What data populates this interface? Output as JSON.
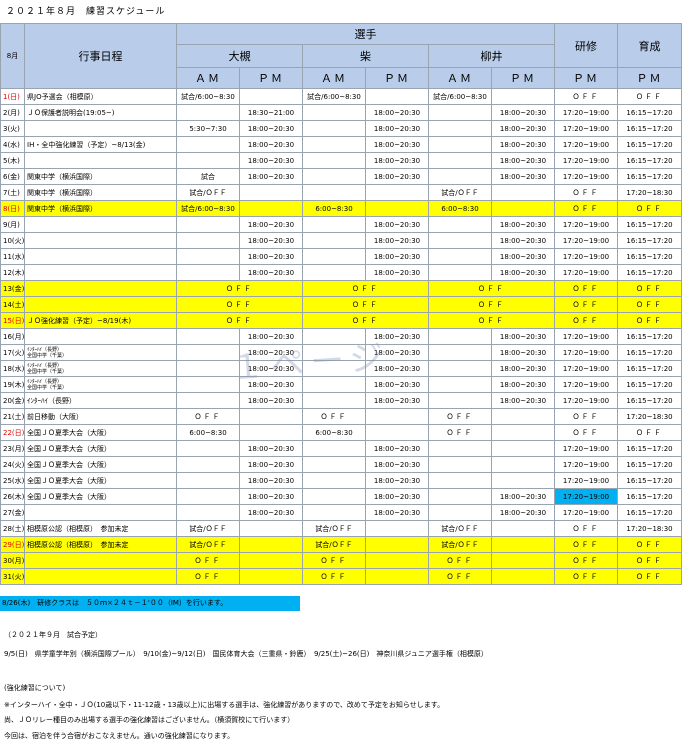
{
  "title": "２０２１年８月　練習スケジュール",
  "header": {
    "month": "8月",
    "event": "行事日程",
    "senshu": "選手",
    "kenshu": "研修",
    "ikusei": "育成",
    "coaches": [
      "大槻",
      "柴",
      "柳井"
    ],
    "am": "ＡＭ",
    "pm": "ＰＭ"
  },
  "rows": [
    {
      "date": "1(日)",
      "red": true,
      "event": "県JO予選会（相模原）",
      "c": [
        "試合/6:00~8:30",
        "",
        "試合/6:00~8:30",
        "",
        "試合/6:00~8:30",
        "",
        "ＯＦＦ",
        "ＯＦＦ"
      ]
    },
    {
      "date": "2(月)",
      "event": "ＪＯ保護者説明会(19:05~)",
      "c": [
        "",
        "18:30~21:00",
        "",
        "18:00~20:30",
        "",
        "18:00~20:30",
        "17:20~19:00",
        "16:15~17:20"
      ]
    },
    {
      "date": "3(火)",
      "event": "",
      "c": [
        "5:30~7:30",
        "18:00~20:30",
        "",
        "18:00~20:30",
        "",
        "18:00~20:30",
        "17:20~19:00",
        "16:15~17:20"
      ]
    },
    {
      "date": "4(水)",
      "event": "IH・全中強化練習（予定）~8/13(金)",
      "c": [
        "",
        "18:00~20:30",
        "",
        "18:00~20:30",
        "",
        "18:00~20:30",
        "17:20~19:00",
        "16:15~17:20"
      ]
    },
    {
      "date": "5(木)",
      "event": "",
      "c": [
        "",
        "18:00~20:30",
        "",
        "18:00~20:30",
        "",
        "18:00~20:30",
        "17:20~19:00",
        "16:15~17:20"
      ]
    },
    {
      "date": "6(金)",
      "event": "関東中学（横浜国際）",
      "c": [
        "試合",
        "18:00~20:30",
        "",
        "18:00~20:30",
        "",
        "18:00~20:30",
        "17:20~19:00",
        "16:15~17:20"
      ]
    },
    {
      "date": "7(土)",
      "event": "関東中学（横浜国際）",
      "c": [
        "試合/ＯＦＦ",
        "",
        "",
        "",
        "試合/ＯＦＦ",
        "",
        "ＯＦＦ",
        "17:20~18:30"
      ]
    },
    {
      "date": "8(日)",
      "red": true,
      "yellow": true,
      "event": "関東中学（横浜国際）",
      "c": [
        "試合/6:00~8:30",
        "",
        "6:00~8:30",
        "",
        "6:00~8:30",
        "",
        "ＯＦＦ",
        "ＯＦＦ"
      ]
    },
    {
      "date": "9(月)",
      "event": "",
      "c": [
        "",
        "18:00~20:30",
        "",
        "18:00~20:30",
        "",
        "18:00~20:30",
        "17:20~19:00",
        "16:15~17:20"
      ]
    },
    {
      "date": "10(火)",
      "event": "",
      "c": [
        "",
        "18:00~20:30",
        "",
        "18:00~20:30",
        "",
        "18:00~20:30",
        "17:20~19:00",
        "16:15~17:20"
      ]
    },
    {
      "date": "11(水)",
      "event": "",
      "c": [
        "",
        "18:00~20:30",
        "",
        "18:00~20:30",
        "",
        "18:00~20:30",
        "17:20~19:00",
        "16:15~17:20"
      ]
    },
    {
      "date": "12(木)",
      "event": "",
      "c": [
        "",
        "18:00~20:30",
        "",
        "18:00~20:30",
        "",
        "18:00~20:30",
        "17:20~19:00",
        "16:15~17:20"
      ]
    },
    {
      "date": "13(金)",
      "yellow": true,
      "event": "",
      "span": [
        "ＯＦＦ",
        "ＯＦＦ",
        "ＯＦＦ"
      ],
      "c2": [
        "ＯＦＦ",
        "ＯＦＦ"
      ]
    },
    {
      "date": "14(土)",
      "yellow": true,
      "event": "",
      "span": [
        "ＯＦＦ",
        "ＯＦＦ",
        "ＯＦＦ"
      ],
      "c2": [
        "ＯＦＦ",
        "ＯＦＦ"
      ]
    },
    {
      "date": "15(日)",
      "red": true,
      "yellow": true,
      "event": "ＪＯ強化練習（予定）~8/19(木)",
      "span": [
        "ＯＦＦ",
        "ＯＦＦ",
        "ＯＦＦ"
      ],
      "c2": [
        "ＯＦＦ",
        "ＯＦＦ"
      ]
    },
    {
      "date": "16(月)",
      "event": "",
      "c": [
        "",
        "18:00~20:30",
        "",
        "18:00~20:30",
        "",
        "18:00~20:30",
        "17:20~19:00",
        "16:15~17:20"
      ]
    },
    {
      "date": "17(火)",
      "event2": [
        "ｲﾝﾀｰﾊｲ（長野）",
        "全国中学（千葉）"
      ],
      "c": [
        "",
        "18:00~20:30",
        "",
        "18:00~20:30",
        "",
        "18:00~20:30",
        "17:20~19:00",
        "16:15~17:20"
      ]
    },
    {
      "date": "18(水)",
      "event2": [
        "ｲﾝﾀｰﾊｲ（長野）",
        "全国中学（千葉）"
      ],
      "c": [
        "",
        "18:00~20:30",
        "",
        "18:00~20:30",
        "",
        "18:00~20:30",
        "17:20~19:00",
        "16:15~17:20"
      ]
    },
    {
      "date": "19(木)",
      "event2": [
        "ｲﾝﾀｰﾊｲ（長野）",
        "全国中学（千葉）"
      ],
      "c": [
        "",
        "18:00~20:30",
        "",
        "18:00~20:30",
        "",
        "18:00~20:30",
        "17:20~19:00",
        "16:15~17:20"
      ]
    },
    {
      "date": "20(金)",
      "event": "ｲﾝﾀｰﾊｲ（長野）",
      "c": [
        "",
        "18:00~20:30",
        "",
        "18:00~20:30",
        "",
        "18:00~20:30",
        "17:20~19:00",
        "16:15~17:20"
      ]
    },
    {
      "date": "21(土)",
      "event": "前日移動（大阪）",
      "c": [
        "ＯＦＦ",
        "",
        "ＯＦＦ",
        "",
        "ＯＦＦ",
        "",
        "ＯＦＦ",
        "17:20~18:30"
      ]
    },
    {
      "date": "22(日)",
      "red": true,
      "event": "全国ＪＯ夏季大会（大阪）",
      "c": [
        "6:00~8:30",
        "",
        "6:00~8:30",
        "",
        "ＯＦＦ",
        "",
        "ＯＦＦ",
        "ＯＦＦ"
      ]
    },
    {
      "date": "23(月)",
      "event": "全国ＪＯ夏季大会（大阪）",
      "c": [
        "",
        "18:00~20:30",
        "",
        "18:00~20:30",
        "",
        "",
        "17:20~19:00",
        "16:15~17:20"
      ]
    },
    {
      "date": "24(火)",
      "event": "全国ＪＯ夏季大会（大阪）",
      "c": [
        "",
        "18:00~20:30",
        "",
        "18:00~20:30",
        "",
        "",
        "17:20~19:00",
        "16:15~17:20"
      ]
    },
    {
      "date": "25(水)",
      "event": "全国ＪＯ夏季大会（大阪）",
      "c": [
        "",
        "18:00~20:30",
        "",
        "18:00~20:30",
        "",
        "",
        "17:20~19:00",
        "16:15~17:20"
      ]
    },
    {
      "date": "26(木)",
      "event": "全国ＪＯ夏季大会（大阪）",
      "blueKenshu": true,
      "c": [
        "",
        "18:00~20:30",
        "",
        "18:00~20:30",
        "",
        "18:00~20:30",
        "17:20~19:00",
        "16:15~17:20"
      ]
    },
    {
      "date": "27(金)",
      "event": "",
      "c": [
        "",
        "18:00~20:30",
        "",
        "18:00~20:30",
        "",
        "18:00~20:30",
        "17:20~19:00",
        "16:15~17:20"
      ]
    },
    {
      "date": "28(土)",
      "event": "相模原公認（相模原）　参加未定",
      "c": [
        "試合/ＯＦＦ",
        "",
        "試合/ＯＦＦ",
        "",
        "試合/ＯＦＦ",
        "",
        "ＯＦＦ",
        "17:20~18:30"
      ]
    },
    {
      "date": "29(日)",
      "red": true,
      "yellow": true,
      "event": "相模原公認（相模原）　参加未定",
      "c": [
        "試合/ＯＦＦ",
        "",
        "試合/ＯＦＦ",
        "",
        "試合/ＯＦＦ",
        "",
        "ＯＦＦ",
        "ＯＦＦ"
      ]
    },
    {
      "date": "30(月)",
      "yellow": true,
      "event": "",
      "c": [
        "ＯＦＦ",
        "",
        "ＯＦＦ",
        "",
        "ＯＦＦ",
        "",
        "ＯＦＦ",
        "ＯＦＦ"
      ]
    },
    {
      "date": "31(火)",
      "yellow": true,
      "event": "",
      "c": [
        "ＯＦＦ",
        "",
        "ＯＦＦ",
        "",
        "ＯＦＦ",
        "",
        "ＯＦＦ",
        "ＯＦＦ"
      ]
    }
  ],
  "watermark": "１ページ",
  "note_bar": "8/26(木)　研修クラスは　５０ｍ×２４ｔ－１'００（IM）を行います。",
  "footer": {
    "sept_title": "（２０２１年９月　試合予定）",
    "sept_line": "9/5(日)　県学童学年別（横浜国際プール）　9/10(金)~9/12(日)　国民体育大会（三重県・鈴鹿）　9/25(土)~26(日)　神奈川県ジュニア選手権（相模原）",
    "strength_title": "(強化練習について)",
    "line1": "※インターハイ・全中・ＪＯ(10歳以下・11-12歳・13歳以上)に出場する選手は、強化練習がありますので、改めて予定をお知らせします。",
    "line2": "尚、ＪＯリレー種目のみ出場する選手の強化練習はございません。（横須賀校にて行います）",
    "line3": "今回は、宿泊を伴う合宿がおこなえません。通いの強化練習になります。"
  }
}
